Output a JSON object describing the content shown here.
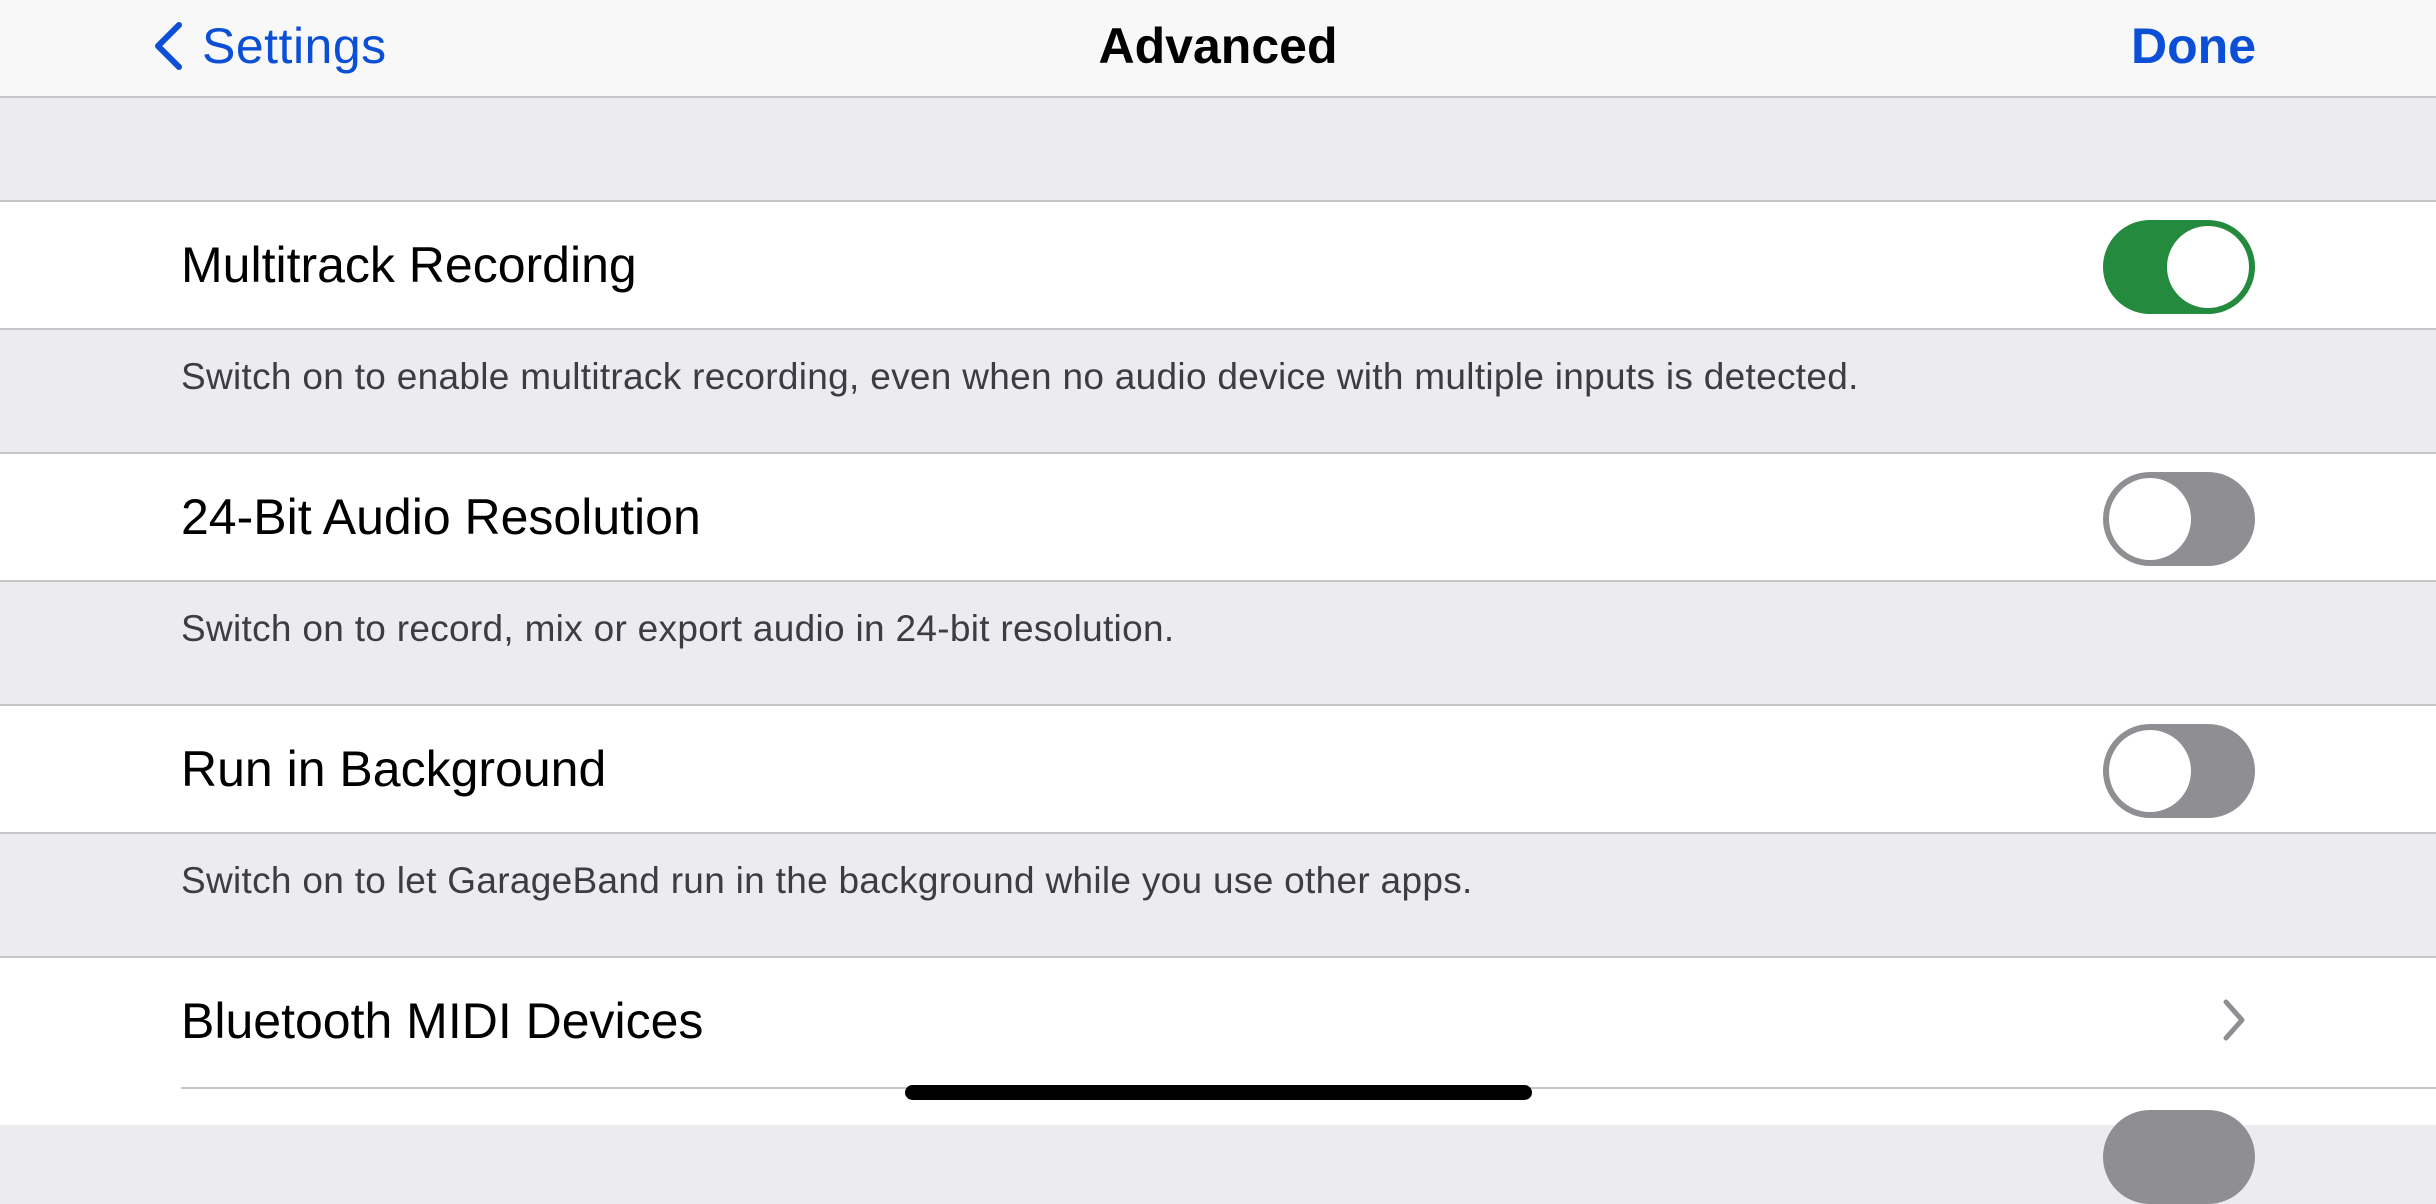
{
  "navbar": {
    "back_label": "Settings",
    "title": "Advanced",
    "done_label": "Done",
    "accent_color": "#0a4fd6"
  },
  "settings": [
    {
      "label": "Multitrack Recording",
      "toggle_on": true,
      "footer": "Switch on to enable multitrack recording, even when no audio device with multiple inputs is detected."
    },
    {
      "label": "24-Bit Audio Resolution",
      "toggle_on": false,
      "footer": "Switch on to record, mix or export audio in 24-bit resolution."
    },
    {
      "label": "Run in Background",
      "toggle_on": false,
      "footer": "Switch on to let GarageBand run in the background while you use other apps."
    },
    {
      "label": "Bluetooth MIDI Devices",
      "accessory": "chevron-right-icon"
    }
  ],
  "colors": {
    "toggle_on": "#248a3d",
    "toggle_off": "#8e8e93",
    "group_background": "#ebebf0",
    "separator": "#c6c6c8"
  }
}
